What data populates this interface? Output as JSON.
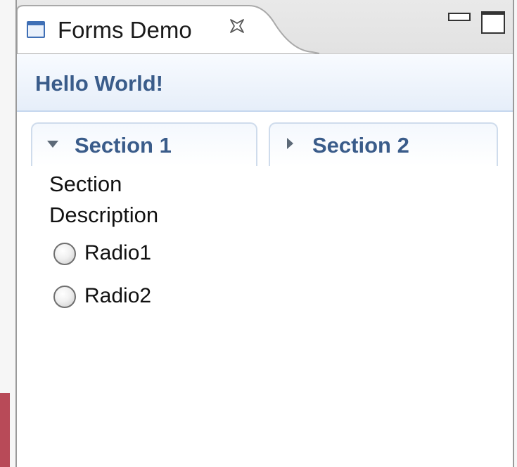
{
  "view": {
    "tab_title": "Forms Demo",
    "close_icon": "close-icon",
    "minimize_icon": "minimize-icon",
    "maximize_icon": "maximize-icon",
    "view_icon": "window-icon"
  },
  "form": {
    "title": "Hello World!"
  },
  "sections": [
    {
      "title": "Section 1",
      "expanded": true,
      "description": "Section Description",
      "radios": [
        {
          "label": "Radio1",
          "selected": false
        },
        {
          "label": "Radio2",
          "selected": false
        }
      ]
    },
    {
      "title": "Section 2",
      "expanded": false
    }
  ],
  "colors": {
    "header_text": "#3a5c8a",
    "accent": "#b84a58",
    "icon_blue": "#3f6fb5"
  }
}
